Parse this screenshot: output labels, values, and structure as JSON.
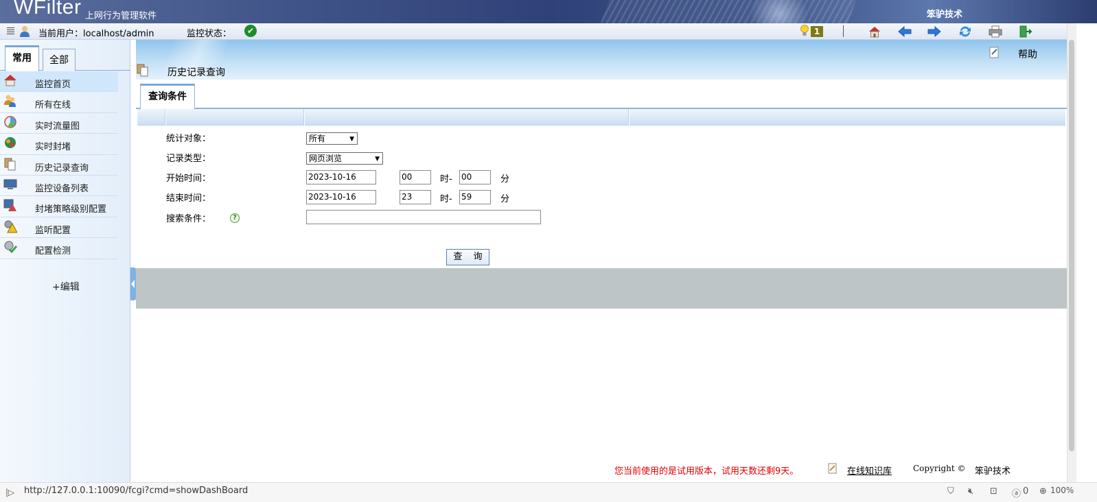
{
  "header": {
    "brand": "WFilter",
    "brand_sub": "上网行为管理软件",
    "company": "笨驴技术"
  },
  "toolbar": {
    "current_user_label": "当前用户：localhost/admin",
    "monitor_status_label": "监控状态：",
    "notification_count": "1",
    "buttons": [
      "home-icon",
      "back-arrow-icon",
      "forward-arrow-icon",
      "refresh-icon",
      "printer-icon",
      "exit-icon"
    ]
  },
  "sidebar": {
    "tabs": [
      {
        "label": "常用",
        "active": true
      },
      {
        "label": "全部",
        "active": false
      }
    ],
    "items": [
      {
        "label": "监控首页",
        "icon": "home-icon",
        "active": true
      },
      {
        "label": "所有在线",
        "icon": "users-icon",
        "active": false
      },
      {
        "label": "实时流量图",
        "icon": "pie-chart-icon",
        "active": false
      },
      {
        "label": "实时封堵",
        "icon": "globe-block-icon",
        "active": false
      },
      {
        "label": "历史记录查询",
        "icon": "documents-icon",
        "active": false
      },
      {
        "label": "监控设备列表",
        "icon": "monitor-icon",
        "active": false
      },
      {
        "label": "封堵策略级别配置",
        "icon": "policy-alert-icon",
        "active": false
      },
      {
        "label": "监听配置",
        "icon": "gear-warning-icon",
        "active": false
      },
      {
        "label": "配置检测",
        "icon": "gear-check-icon",
        "active": false
      }
    ],
    "edit_label": "+编辑"
  },
  "main": {
    "help_label": "帮助",
    "page_title": "历史记录查询",
    "condition_tab": "查询条件",
    "form": {
      "target_label": "统计对象：",
      "target_value": "所有",
      "type_label": "记录类型：",
      "type_value": "网页浏览",
      "start_label": "开始时间：",
      "start_date": "2023-10-16",
      "start_hour": "00",
      "start_minute": "00",
      "end_label": "结束时间：",
      "end_date": "2023-10-16",
      "end_hour": "23",
      "end_minute": "59",
      "hour_unit": "时-",
      "minute_unit": "分",
      "search_label": "搜索条件：",
      "search_value": "",
      "query_button": "查 询"
    },
    "footer": {
      "trial_notice": "您当前使用的是试用版本，试用天数还剩9天。",
      "kb_link": "在线知识库",
      "copyright": "Copyright ©",
      "company": "笨驴技术"
    }
  },
  "statusbar": {
    "url": "http://127.0.0.1:10090/fcgi?cmd=showDashBoard",
    "badge_count": "0",
    "zoom": "100%"
  }
}
